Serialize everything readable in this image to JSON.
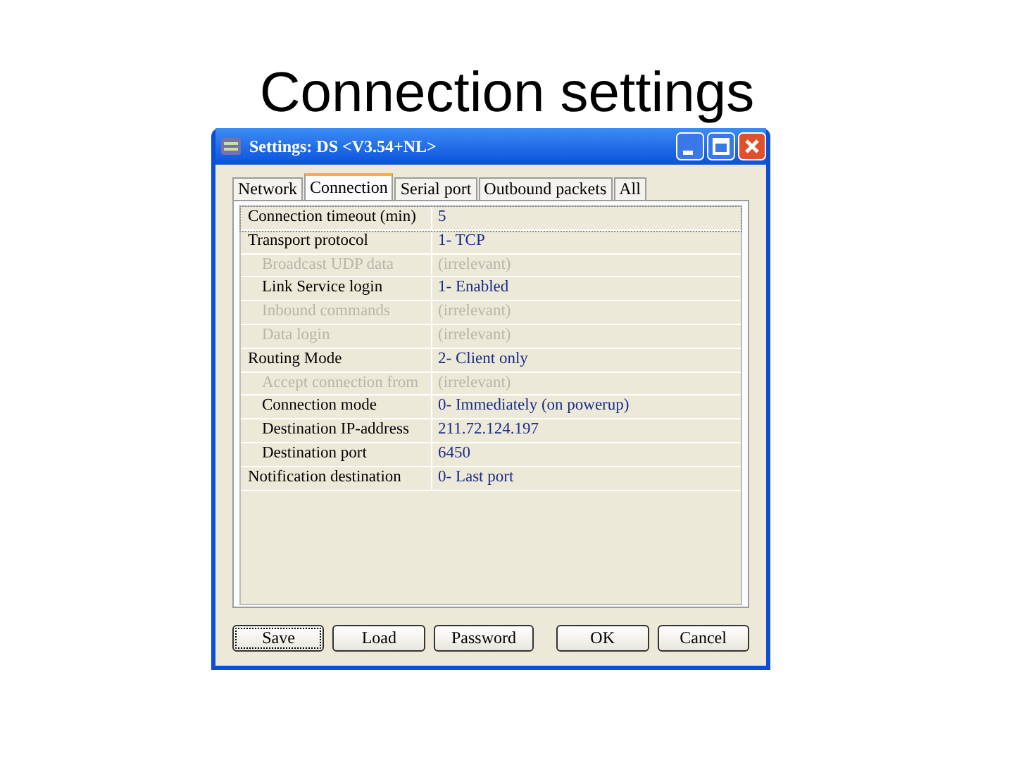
{
  "slide": {
    "title": "Connection settings"
  },
  "window": {
    "title": "Settings: DS <V3.54+NL>"
  },
  "tabs": [
    {
      "label": "Network",
      "selected": false
    },
    {
      "label": "Connection",
      "selected": true
    },
    {
      "label": "Serial port",
      "selected": false
    },
    {
      "label": "Outbound packets",
      "selected": false
    },
    {
      "label": "All",
      "selected": false
    }
  ],
  "settings": [
    {
      "label": "Connection timeout (min)",
      "value": "5",
      "disabled": false,
      "selected": true
    },
    {
      "label": "Transport protocol",
      "value": "1- TCP",
      "disabled": false,
      "selected": false,
      "children": [
        {
          "label": "Broadcast UDP data",
          "value": "(irrelevant)",
          "disabled": true,
          "selected": false
        },
        {
          "label": "Link Service login",
          "value": "1- Enabled",
          "disabled": false,
          "selected": false
        },
        {
          "label": "Inbound commands",
          "value": "(irrelevant)",
          "disabled": true,
          "selected": false
        },
        {
          "label": "Data login",
          "value": "(irrelevant)",
          "disabled": true,
          "selected": false
        }
      ]
    },
    {
      "label": "Routing Mode",
      "value": "2- Client only",
      "disabled": false,
      "selected": false,
      "children": [
        {
          "label": "Accept connection from",
          "value": "(irrelevant)",
          "disabled": true,
          "selected": false
        },
        {
          "label": "Connection mode",
          "value": "0- Immediately (on powerup)",
          "disabled": false,
          "selected": false
        },
        {
          "label": "Destination IP-address",
          "value": "211.72.124.197",
          "disabled": false,
          "selected": false
        },
        {
          "label": "Destination port",
          "value": "6450",
          "disabled": false,
          "selected": false
        }
      ]
    },
    {
      "label": "Notification destination",
      "value": "0- Last port",
      "disabled": false,
      "selected": false
    }
  ],
  "buttons": [
    {
      "label": "Save",
      "focused": true
    },
    {
      "label": "Load",
      "focused": false
    },
    {
      "label": "Password",
      "focused": false
    },
    {
      "label": "OK",
      "focused": false
    },
    {
      "label": "Cancel",
      "focused": false
    }
  ]
}
